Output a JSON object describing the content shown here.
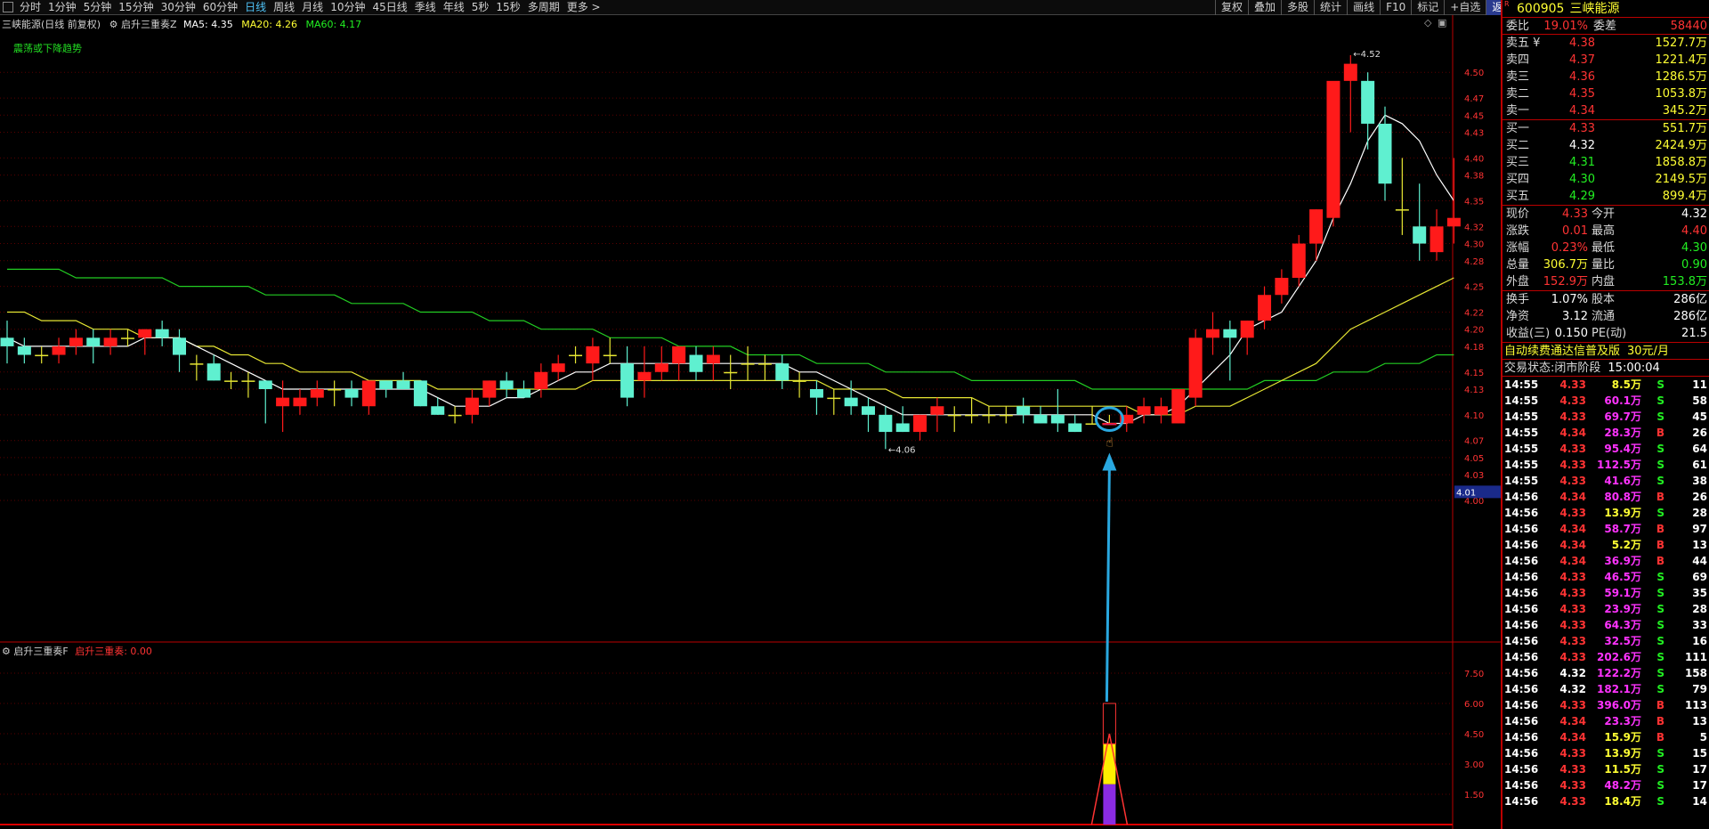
{
  "toolbar": {
    "periods": [
      "分时",
      "1分钟",
      "5分钟",
      "15分钟",
      "30分钟",
      "60分钟",
      "日线",
      "周线",
      "月线",
      "10分钟",
      "45日线",
      "季线",
      "年线",
      "5秒",
      "15秒",
      "多周期",
      "更多 >"
    ],
    "active_period": "日线",
    "right_buttons": [
      "复权",
      "叠加",
      "多股",
      "统计",
      "画线",
      "F10",
      "标记",
      "+自选",
      "返回"
    ]
  },
  "main_legend": {
    "stock": "三峡能源(日线 前复权)",
    "indicator": "启升三重奏Z",
    "ma5": "MA5: 4.35",
    "ma20": "MA20: 4.26",
    "ma60": "MA60: 4.17"
  },
  "signal_text": "震荡或下降趋势",
  "sub_legend": {
    "name": "启升三重奏F",
    "value_label": "启升三重奏: 0.00"
  },
  "price_marks": {
    "high": "4.52",
    "low": "4.06",
    "cursor": "4.01"
  },
  "chart_data": {
    "type": "candlestick",
    "price_axis_ticks": [
      "4.50",
      "4.47",
      "4.45",
      "4.43",
      "4.40",
      "4.38",
      "4.35",
      "4.32",
      "4.30",
      "4.28",
      "4.25",
      "4.22",
      "4.20",
      "4.18",
      "4.15",
      "4.13",
      "4.10",
      "4.07",
      "4.05",
      "4.03",
      "4.00"
    ],
    "sub_axis_ticks": [
      "7.50",
      "6.00",
      "4.50",
      "3.00",
      "1.50"
    ],
    "candles": [
      {
        "o": 4.19,
        "h": 4.21,
        "l": 4.16,
        "c": 4.18
      },
      {
        "o": 4.18,
        "h": 4.19,
        "l": 4.16,
        "c": 4.17
      },
      {
        "o": 4.17,
        "h": 4.18,
        "l": 4.16,
        "c": 4.17
      },
      {
        "o": 4.17,
        "h": 4.19,
        "l": 4.16,
        "c": 4.18
      },
      {
        "o": 4.18,
        "h": 4.2,
        "l": 4.17,
        "c": 4.19
      },
      {
        "o": 4.19,
        "h": 4.2,
        "l": 4.16,
        "c": 4.18
      },
      {
        "o": 4.18,
        "h": 4.2,
        "l": 4.17,
        "c": 4.19
      },
      {
        "o": 4.19,
        "h": 4.2,
        "l": 4.18,
        "c": 4.19
      },
      {
        "o": 4.19,
        "h": 4.2,
        "l": 4.17,
        "c": 4.2
      },
      {
        "o": 4.2,
        "h": 4.21,
        "l": 4.18,
        "c": 4.19
      },
      {
        "o": 4.19,
        "h": 4.2,
        "l": 4.15,
        "c": 4.17
      },
      {
        "o": 4.16,
        "h": 4.17,
        "l": 4.14,
        "c": 4.16
      },
      {
        "o": 4.16,
        "h": 4.17,
        "l": 4.14,
        "c": 4.14
      },
      {
        "o": 4.14,
        "h": 4.15,
        "l": 4.13,
        "c": 4.14
      },
      {
        "o": 4.14,
        "h": 4.15,
        "l": 4.12,
        "c": 4.14
      },
      {
        "o": 4.14,
        "h": 4.14,
        "l": 4.09,
        "c": 4.13
      },
      {
        "o": 4.11,
        "h": 4.14,
        "l": 4.08,
        "c": 4.12
      },
      {
        "o": 4.11,
        "h": 4.13,
        "l": 4.1,
        "c": 4.12
      },
      {
        "o": 4.12,
        "h": 4.14,
        "l": 4.11,
        "c": 4.13
      },
      {
        "o": 4.13,
        "h": 4.14,
        "l": 4.11,
        "c": 4.13
      },
      {
        "o": 4.13,
        "h": 4.14,
        "l": 4.11,
        "c": 4.12
      },
      {
        "o": 4.11,
        "h": 4.14,
        "l": 4.1,
        "c": 4.14
      },
      {
        "o": 4.14,
        "h": 4.14,
        "l": 4.12,
        "c": 4.13
      },
      {
        "o": 4.14,
        "h": 4.15,
        "l": 4.13,
        "c": 4.13
      },
      {
        "o": 4.14,
        "h": 4.14,
        "l": 4.11,
        "c": 4.11
      },
      {
        "o": 4.11,
        "h": 4.12,
        "l": 4.1,
        "c": 4.1
      },
      {
        "o": 4.1,
        "h": 4.11,
        "l": 4.09,
        "c": 4.1
      },
      {
        "o": 4.1,
        "h": 4.13,
        "l": 4.09,
        "c": 4.12
      },
      {
        "o": 4.12,
        "h": 4.14,
        "l": 4.11,
        "c": 4.14
      },
      {
        "o": 4.14,
        "h": 4.15,
        "l": 4.12,
        "c": 4.13
      },
      {
        "o": 4.13,
        "h": 4.14,
        "l": 4.12,
        "c": 4.12
      },
      {
        "o": 4.13,
        "h": 4.16,
        "l": 4.12,
        "c": 4.15
      },
      {
        "o": 4.15,
        "h": 4.17,
        "l": 4.14,
        "c": 4.16
      },
      {
        "o": 4.17,
        "h": 4.18,
        "l": 4.16,
        "c": 4.17
      },
      {
        "o": 4.16,
        "h": 4.19,
        "l": 4.14,
        "c": 4.18
      },
      {
        "o": 4.17,
        "h": 4.19,
        "l": 4.16,
        "c": 4.17
      },
      {
        "o": 4.16,
        "h": 4.18,
        "l": 4.11,
        "c": 4.12
      },
      {
        "o": 4.14,
        "h": 4.18,
        "l": 4.12,
        "c": 4.15
      },
      {
        "o": 4.15,
        "h": 4.18,
        "l": 4.14,
        "c": 4.16
      },
      {
        "o": 4.16,
        "h": 4.18,
        "l": 4.14,
        "c": 4.18
      },
      {
        "o": 4.17,
        "h": 4.18,
        "l": 4.14,
        "c": 4.15
      },
      {
        "o": 4.16,
        "h": 4.18,
        "l": 4.14,
        "c": 4.17
      },
      {
        "o": 4.15,
        "h": 4.17,
        "l": 4.13,
        "c": 4.15
      },
      {
        "o": 4.16,
        "h": 4.18,
        "l": 4.14,
        "c": 4.16
      },
      {
        "o": 4.16,
        "h": 4.17,
        "l": 4.14,
        "c": 4.16
      },
      {
        "o": 4.16,
        "h": 4.17,
        "l": 4.13,
        "c": 4.14
      },
      {
        "o": 4.14,
        "h": 4.15,
        "l": 4.12,
        "c": 4.14
      },
      {
        "o": 4.13,
        "h": 4.14,
        "l": 4.1,
        "c": 4.12
      },
      {
        "o": 4.12,
        "h": 4.13,
        "l": 4.1,
        "c": 4.12
      },
      {
        "o": 4.12,
        "h": 4.14,
        "l": 4.1,
        "c": 4.11
      },
      {
        "o": 4.11,
        "h": 4.12,
        "l": 4.08,
        "c": 4.1
      },
      {
        "o": 4.1,
        "h": 4.11,
        "l": 4.06,
        "c": 4.08
      },
      {
        "o": 4.09,
        "h": 4.11,
        "l": 4.08,
        "c": 4.08
      },
      {
        "o": 4.08,
        "h": 4.1,
        "l": 4.07,
        "c": 4.1
      },
      {
        "o": 4.1,
        "h": 4.12,
        "l": 4.08,
        "c": 4.11
      },
      {
        "o": 4.1,
        "h": 4.11,
        "l": 4.08,
        "c": 4.1
      },
      {
        "o": 4.1,
        "h": 4.12,
        "l": 4.09,
        "c": 4.1
      },
      {
        "o": 4.1,
        "h": 4.11,
        "l": 4.09,
        "c": 4.1
      },
      {
        "o": 4.1,
        "h": 4.11,
        "l": 4.09,
        "c": 4.1
      },
      {
        "o": 4.11,
        "h": 4.12,
        "l": 4.09,
        "c": 4.1
      },
      {
        "o": 4.1,
        "h": 4.11,
        "l": 4.09,
        "c": 4.09
      },
      {
        "o": 4.1,
        "h": 4.13,
        "l": 4.08,
        "c": 4.09
      },
      {
        "o": 4.09,
        "h": 4.1,
        "l": 4.08,
        "c": 4.08
      },
      {
        "o": 4.09,
        "h": 4.11,
        "l": 4.09,
        "c": 4.09
      },
      {
        "o": 4.09,
        "h": 4.1,
        "l": 4.09,
        "c": 4.09
      },
      {
        "o": 4.09,
        "h": 4.11,
        "l": 4.08,
        "c": 4.1
      },
      {
        "o": 4.1,
        "h": 4.12,
        "l": 4.09,
        "c": 4.11
      },
      {
        "o": 4.1,
        "h": 4.12,
        "l": 4.09,
        "c": 4.11
      },
      {
        "o": 4.09,
        "h": 4.13,
        "l": 4.09,
        "c": 4.13
      },
      {
        "o": 4.12,
        "h": 4.2,
        "l": 4.11,
        "c": 4.19
      },
      {
        "o": 4.19,
        "h": 4.22,
        "l": 4.17,
        "c": 4.2
      },
      {
        "o": 4.2,
        "h": 4.21,
        "l": 4.14,
        "c": 4.19
      },
      {
        "o": 4.19,
        "h": 4.21,
        "l": 4.17,
        "c": 4.21
      },
      {
        "o": 4.21,
        "h": 4.25,
        "l": 4.2,
        "c": 4.24
      },
      {
        "o": 4.24,
        "h": 4.27,
        "l": 4.23,
        "c": 4.26
      },
      {
        "o": 4.26,
        "h": 4.31,
        "l": 4.25,
        "c": 4.3
      },
      {
        "o": 4.3,
        "h": 4.34,
        "l": 4.28,
        "c": 4.34
      },
      {
        "o": 4.33,
        "h": 4.41,
        "l": 4.32,
        "c": 4.49
      },
      {
        "o": 4.49,
        "h": 4.52,
        "l": 4.43,
        "c": 4.51
      },
      {
        "o": 4.49,
        "h": 4.5,
        "l": 4.41,
        "c": 4.44
      },
      {
        "o": 4.44,
        "h": 4.46,
        "l": 4.35,
        "c": 4.37
      },
      {
        "o": 4.34,
        "h": 4.4,
        "l": 4.31,
        "c": 4.34
      },
      {
        "o": 4.32,
        "h": 4.37,
        "l": 4.28,
        "c": 4.3
      },
      {
        "o": 4.29,
        "h": 4.34,
        "l": 4.28,
        "c": 4.32
      },
      {
        "o": 4.32,
        "h": 4.4,
        "l": 4.3,
        "c": 4.33
      }
    ],
    "ma5": [
      4.19,
      4.18,
      4.18,
      4.18,
      4.18,
      4.18,
      4.18,
      4.18,
      4.19,
      4.19,
      4.19,
      4.18,
      4.17,
      4.16,
      4.15,
      4.14,
      4.13,
      4.13,
      4.13,
      4.13,
      4.13,
      4.13,
      4.13,
      4.13,
      4.13,
      4.12,
      4.11,
      4.11,
      4.11,
      4.12,
      4.12,
      4.13,
      4.14,
      4.15,
      4.15,
      4.16,
      4.16,
      4.16,
      4.16,
      4.16,
      4.16,
      4.16,
      4.16,
      4.16,
      4.16,
      4.16,
      4.15,
      4.15,
      4.14,
      4.13,
      4.12,
      4.11,
      4.1,
      4.1,
      4.1,
      4.1,
      4.1,
      4.1,
      4.1,
      4.1,
      4.1,
      4.1,
      4.1,
      4.1,
      4.09,
      4.09,
      4.1,
      4.1,
      4.11,
      4.13,
      4.15,
      4.17,
      4.2,
      4.21,
      4.22,
      4.25,
      4.28,
      4.33,
      4.37,
      4.42,
      4.45,
      4.44,
      4.42,
      4.38,
      4.35
    ],
    "ma20": [
      4.22,
      4.22,
      4.21,
      4.21,
      4.21,
      4.2,
      4.2,
      4.2,
      4.19,
      4.19,
      4.19,
      4.18,
      4.18,
      4.17,
      4.17,
      4.16,
      4.16,
      4.15,
      4.15,
      4.15,
      4.15,
      4.14,
      4.14,
      4.14,
      4.14,
      4.13,
      4.13,
      4.13,
      4.13,
      4.13,
      4.13,
      4.13,
      4.13,
      4.13,
      4.14,
      4.14,
      4.14,
      4.14,
      4.14,
      4.14,
      4.14,
      4.14,
      4.14,
      4.14,
      4.14,
      4.14,
      4.14,
      4.14,
      4.13,
      4.13,
      4.13,
      4.13,
      4.12,
      4.12,
      4.12,
      4.12,
      4.12,
      4.11,
      4.11,
      4.11,
      4.11,
      4.11,
      4.11,
      4.11,
      4.11,
      4.11,
      4.1,
      4.1,
      4.1,
      4.11,
      4.11,
      4.11,
      4.12,
      4.13,
      4.14,
      4.15,
      4.16,
      4.18,
      4.2,
      4.21,
      4.22,
      4.23,
      4.24,
      4.25,
      4.26
    ],
    "ma60": [
      4.27,
      4.27,
      4.27,
      4.27,
      4.26,
      4.26,
      4.26,
      4.26,
      4.26,
      4.26,
      4.25,
      4.25,
      4.25,
      4.25,
      4.25,
      4.24,
      4.24,
      4.24,
      4.24,
      4.24,
      4.23,
      4.23,
      4.23,
      4.23,
      4.22,
      4.22,
      4.22,
      4.22,
      4.21,
      4.21,
      4.21,
      4.2,
      4.2,
      4.2,
      4.2,
      4.19,
      4.19,
      4.19,
      4.19,
      4.18,
      4.18,
      4.18,
      4.18,
      4.17,
      4.17,
      4.17,
      4.17,
      4.16,
      4.16,
      4.16,
      4.16,
      4.15,
      4.15,
      4.15,
      4.15,
      4.15,
      4.14,
      4.14,
      4.14,
      4.14,
      4.14,
      4.14,
      4.14,
      4.13,
      4.13,
      4.13,
      4.13,
      4.13,
      4.13,
      4.13,
      4.13,
      4.13,
      4.13,
      4.14,
      4.14,
      4.14,
      4.14,
      4.15,
      4.15,
      4.15,
      4.16,
      4.16,
      4.16,
      4.17,
      4.17
    ],
    "signal": {
      "candle_index": 64,
      "value": 6.0
    }
  },
  "panel": {
    "code": "600905",
    "name": "三峡能源",
    "weibi_label": "委比",
    "weibi": "19.01%",
    "weicha_label": "委差",
    "weicha": "58440",
    "asks": [
      {
        "label": "卖五 ¥",
        "price": "4.38",
        "vol": "1527.7万"
      },
      {
        "label": "卖四",
        "price": "4.37",
        "vol": "1221.4万"
      },
      {
        "label": "卖三",
        "price": "4.36",
        "vol": "1286.5万"
      },
      {
        "label": "卖二",
        "price": "4.35",
        "vol": "1053.8万"
      },
      {
        "label": "卖一",
        "price": "4.34",
        "vol": "345.2万"
      }
    ],
    "bids": [
      {
        "label": "买一",
        "price": "4.33",
        "vol": "551.7万",
        "color": "red"
      },
      {
        "label": "买二",
        "price": "4.32",
        "vol": "2424.9万",
        "color": "white"
      },
      {
        "label": "买三",
        "price": "4.31",
        "vol": "1858.8万",
        "color": "green"
      },
      {
        "label": "买四",
        "price": "4.30",
        "vol": "2149.5万",
        "color": "green"
      },
      {
        "label": "买五",
        "price": "4.29",
        "vol": "899.4万",
        "color": "green"
      }
    ],
    "stats": [
      {
        "l1": "现价",
        "v1": "4.33",
        "c1": "red",
        "l2": "今开",
        "v2": "4.32",
        "c2": "white"
      },
      {
        "l1": "涨跌",
        "v1": "0.01",
        "c1": "red",
        "l2": "最高",
        "v2": "4.40",
        "c2": "red"
      },
      {
        "l1": "涨幅",
        "v1": "0.23%",
        "c1": "red",
        "l2": "最低",
        "v2": "4.30",
        "c2": "green"
      },
      {
        "l1": "总量",
        "v1": "306.7万",
        "c1": "yellow",
        "l2": "量比",
        "v2": "0.90",
        "c2": "green"
      },
      {
        "l1": "外盘",
        "v1": "152.9万",
        "c1": "red",
        "l2": "内盘",
        "v2": "153.8万",
        "c2": "green"
      }
    ],
    "stats2": [
      {
        "l1": "换手",
        "v1": "1.07%",
        "l2": "股本",
        "v2": "286亿"
      },
      {
        "l1": "净资",
        "v1": "3.12",
        "l2": "流通",
        "v2": "286亿"
      },
      {
        "l1": "收益(三)",
        "v1": "0.150",
        "l2": "PE(动)",
        "v2": "21.5"
      }
    ],
    "ad_text": "自动续费通达信普及版",
    "ad_price": "30元/月",
    "status_label": "交易状态:",
    "status_value": "闭市阶段",
    "status_time": "15:00:04",
    "ticks": [
      {
        "t": "14:55",
        "p": "4.33",
        "pc": "red",
        "v": "8.5万",
        "vc": "yellow",
        "bs": "S",
        "n": "11"
      },
      {
        "t": "14:55",
        "p": "4.33",
        "pc": "red",
        "v": "60.1万",
        "vc": "mag",
        "bs": "S",
        "n": "58"
      },
      {
        "t": "14:55",
        "p": "4.33",
        "pc": "red",
        "v": "69.7万",
        "vc": "mag",
        "bs": "S",
        "n": "45"
      },
      {
        "t": "14:55",
        "p": "4.34",
        "pc": "red",
        "v": "28.3万",
        "vc": "mag",
        "bs": "B",
        "n": "26"
      },
      {
        "t": "14:55",
        "p": "4.33",
        "pc": "red",
        "v": "95.4万",
        "vc": "mag",
        "bs": "S",
        "n": "64"
      },
      {
        "t": "14:55",
        "p": "4.33",
        "pc": "red",
        "v": "112.5万",
        "vc": "mag",
        "bs": "S",
        "n": "61"
      },
      {
        "t": "14:55",
        "p": "4.33",
        "pc": "red",
        "v": "41.6万",
        "vc": "mag",
        "bs": "S",
        "n": "38"
      },
      {
        "t": "14:56",
        "p": "4.34",
        "pc": "red",
        "v": "80.8万",
        "vc": "mag",
        "bs": "B",
        "n": "26"
      },
      {
        "t": "14:56",
        "p": "4.33",
        "pc": "red",
        "v": "13.9万",
        "vc": "yellow",
        "bs": "S",
        "n": "28"
      },
      {
        "t": "14:56",
        "p": "4.34",
        "pc": "red",
        "v": "58.7万",
        "vc": "mag",
        "bs": "B",
        "n": "97"
      },
      {
        "t": "14:56",
        "p": "4.34",
        "pc": "red",
        "v": "5.2万",
        "vc": "yellow",
        "bs": "B",
        "n": "13"
      },
      {
        "t": "14:56",
        "p": "4.34",
        "pc": "red",
        "v": "36.9万",
        "vc": "mag",
        "bs": "B",
        "n": "44"
      },
      {
        "t": "14:56",
        "p": "4.33",
        "pc": "red",
        "v": "46.5万",
        "vc": "mag",
        "bs": "S",
        "n": "69"
      },
      {
        "t": "14:56",
        "p": "4.33",
        "pc": "red",
        "v": "59.1万",
        "vc": "mag",
        "bs": "S",
        "n": "35"
      },
      {
        "t": "14:56",
        "p": "4.33",
        "pc": "red",
        "v": "23.9万",
        "vc": "mag",
        "bs": "S",
        "n": "28"
      },
      {
        "t": "14:56",
        "p": "4.33",
        "pc": "red",
        "v": "64.3万",
        "vc": "mag",
        "bs": "S",
        "n": "33"
      },
      {
        "t": "14:56",
        "p": "4.33",
        "pc": "red",
        "v": "32.5万",
        "vc": "mag",
        "bs": "S",
        "n": "16"
      },
      {
        "t": "14:56",
        "p": "4.33",
        "pc": "red",
        "v": "202.6万",
        "vc": "mag",
        "bs": "S",
        "n": "111"
      },
      {
        "t": "14:56",
        "p": "4.32",
        "pc": "white",
        "v": "122.2万",
        "vc": "mag",
        "bs": "S",
        "n": "158"
      },
      {
        "t": "14:56",
        "p": "4.32",
        "pc": "white",
        "v": "182.1万",
        "vc": "mag",
        "bs": "S",
        "n": "79"
      },
      {
        "t": "14:56",
        "p": "4.33",
        "pc": "red",
        "v": "396.0万",
        "vc": "mag",
        "bs": "B",
        "n": "113"
      },
      {
        "t": "14:56",
        "p": "4.34",
        "pc": "red",
        "v": "23.3万",
        "vc": "mag",
        "bs": "B",
        "n": "13"
      },
      {
        "t": "14:56",
        "p": "4.34",
        "pc": "red",
        "v": "15.9万",
        "vc": "yellow",
        "bs": "B",
        "n": "5"
      },
      {
        "t": "14:56",
        "p": "4.33",
        "pc": "red",
        "v": "13.9万",
        "vc": "yellow",
        "bs": "S",
        "n": "15"
      },
      {
        "t": "14:56",
        "p": "4.33",
        "pc": "red",
        "v": "11.5万",
        "vc": "yellow",
        "bs": "S",
        "n": "17"
      },
      {
        "t": "14:56",
        "p": "4.33",
        "pc": "red",
        "v": "48.2万",
        "vc": "mag",
        "bs": "S",
        "n": "17"
      },
      {
        "t": "14:56",
        "p": "4.33",
        "pc": "red",
        "v": "18.4万",
        "vc": "yellow",
        "bs": "S",
        "n": "14"
      }
    ]
  }
}
